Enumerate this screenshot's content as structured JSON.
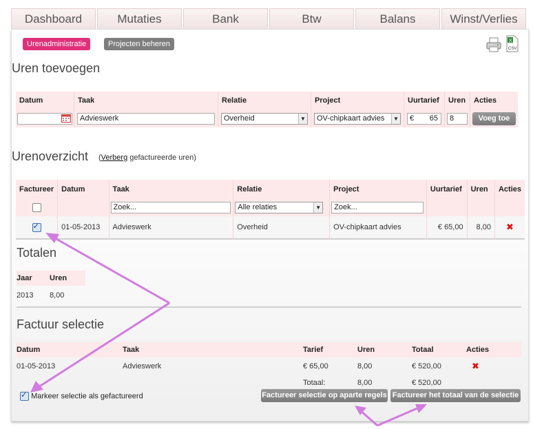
{
  "nav": {
    "tabs": [
      "Dashboard",
      "Mutaties",
      "Bank",
      "Btw",
      "Balans",
      "Winst/Verlies"
    ]
  },
  "subnav": {
    "uren": "Urenadministratie",
    "projecten": "Projecten beheren"
  },
  "icons": {
    "print": "printer-icon",
    "csv": "csv-icon",
    "csv_label": "CSV"
  },
  "colors": {
    "accent": "#e0307a",
    "tab_bg": "#f5e8e8",
    "header_row": "#fde9ea",
    "button_gray": "#888888",
    "delete": "#e01010"
  },
  "add": {
    "title": "Uren toevoegen",
    "headers": [
      "Datum",
      "Taak",
      "Relatie",
      "Project",
      "Uurtarief",
      "Uren",
      "Acties"
    ],
    "datum": "",
    "taak": "Advieswerk",
    "relatie": "Overheid",
    "project": "OV-chipkaart advies",
    "currency": "€",
    "tarief": "65",
    "uren": "8",
    "button": "Voeg toe"
  },
  "overview": {
    "title": "Urenoverzicht",
    "toggle_prefix": "(",
    "toggle_link": "Verberg",
    "toggle_suffix": " gefactureerde uren)",
    "headers": [
      "Factureer",
      "Datum",
      "Taak",
      "Relatie",
      "Project",
      "Uurtarief",
      "Uren",
      "Acties"
    ],
    "filter_taak": "Zoek...",
    "filter_relatie": "Alle relaties",
    "filter_project": "Zoek...",
    "row": {
      "datum": "01-05-2013",
      "taak": "Advieswerk",
      "relatie": "Overheid",
      "project": "OV-chipkaart advies",
      "tarief": "€ 65,00",
      "uren": "8,00"
    }
  },
  "totals": {
    "title": "Totalen",
    "headers": [
      "Jaar",
      "Uren"
    ],
    "jaar": "2013",
    "uren": "8,00"
  },
  "invoice": {
    "title": "Factuur selectie",
    "headers": [
      "Datum",
      "Taak",
      "Tarief",
      "Uren",
      "Totaal",
      "Acties"
    ],
    "row": {
      "datum": "01-05-2013",
      "taak": "Advieswerk",
      "tarief": "€ 65,00",
      "uren": "8,00",
      "totaal": "€ 520,00"
    },
    "sum": {
      "label": "Totaal:",
      "uren": "8,00",
      "totaal": "€ 520,00"
    },
    "mark_label": "Markeer selectie als gefactureerd",
    "btn_separate": "Factureer selectie op aparte regels",
    "btn_total": "Factureer het totaal van de selectie"
  }
}
